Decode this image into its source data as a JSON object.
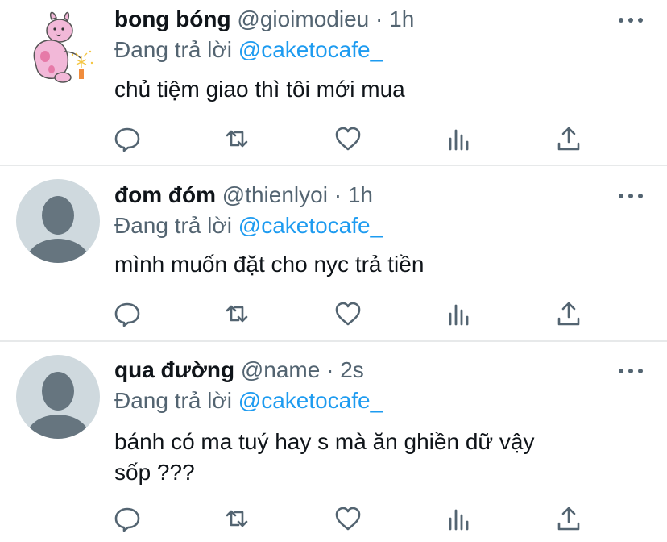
{
  "replies": [
    {
      "name": "bong bóng",
      "handle": "@gioimodieu",
      "time": "· 1h",
      "reply_prefix": "Đang trả lời",
      "reply_to": "@caketocafe_",
      "lines": [
        "chủ tiệm giao thì tôi mới mua"
      ]
    },
    {
      "name": "đom đóm",
      "handle": "@thienlyoi",
      "time": "· 1h",
      "reply_prefix": "Đang trả lời",
      "reply_to": "@caketocafe_",
      "lines": [
        "mình muốn đặt cho nyc trả tiền"
      ]
    },
    {
      "name": "qua đường",
      "handle": "@name",
      "time": "· 2s",
      "reply_prefix": "Đang trả lời",
      "reply_to": "@caketocafe_",
      "lines": [
        "bánh có ma tuý hay s mà ăn ghiền dữ vậy",
        "sốp ???"
      ]
    }
  ],
  "colors": {
    "accent": "#1d9bf0",
    "secondary_text": "#536471",
    "primary_text": "#0f1419",
    "divider": "#e7e9ea",
    "default_avatar": "#cfd9de"
  },
  "icons": [
    "reply-icon",
    "retweet-icon",
    "like-icon",
    "analytics-icon",
    "share-icon",
    "more-icon"
  ]
}
